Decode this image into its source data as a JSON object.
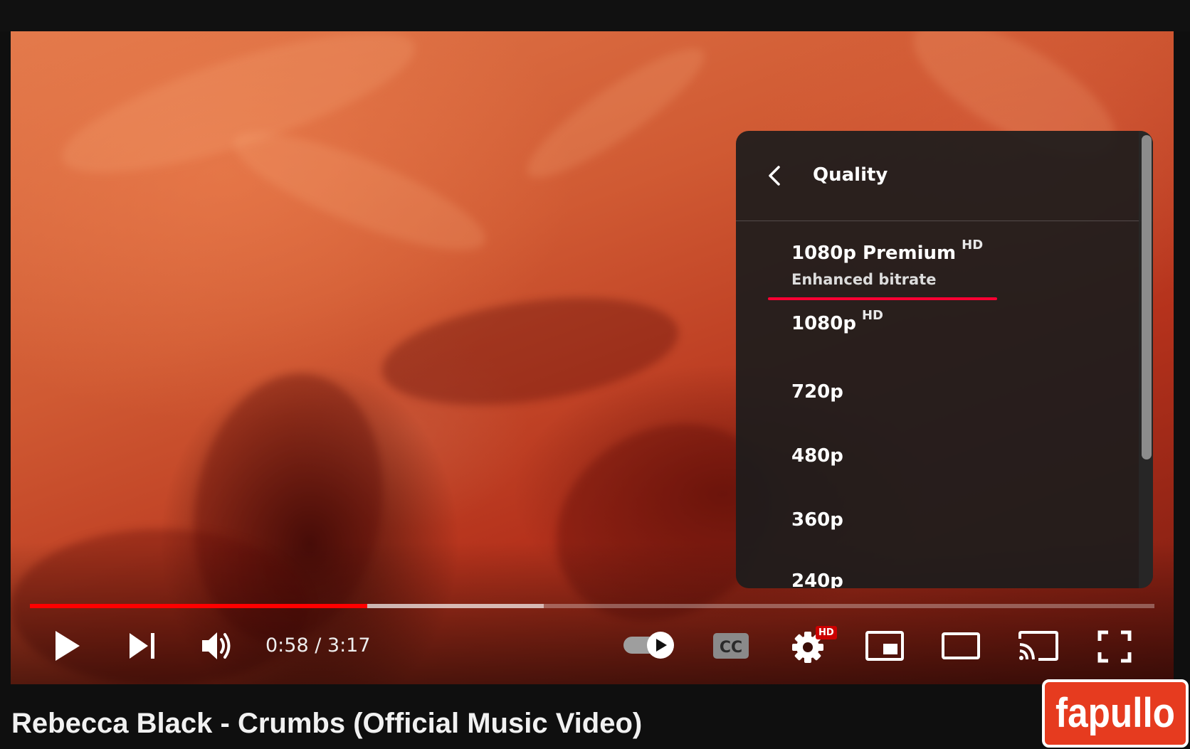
{
  "video": {
    "title": "Rebecca Black - Crumbs (Official Music Video)"
  },
  "player": {
    "progress": {
      "played_fraction": 0.3,
      "buffered_fraction": 0.457
    },
    "time": {
      "current": "0:58",
      "separator": " / ",
      "duration": "3:17"
    },
    "autoplay": {
      "enabled": true
    },
    "settings_badge": "HD",
    "icons": {
      "play": "play-icon",
      "next": "next-icon",
      "volume": "volume-icon",
      "autoplay": "autoplay-toggle-icon",
      "cc": "captions-icon",
      "settings": "gear-icon",
      "miniplayer": "miniplayer-icon",
      "theater": "theater-mode-icon",
      "cast": "cast-icon",
      "fullscreen": "fullscreen-icon"
    },
    "colors": {
      "progress": "#ff0000",
      "accent": "#ff0033",
      "badge": "#cc0000"
    }
  },
  "quality_menu": {
    "title": "Quality",
    "items": [
      {
        "label": "1080p Premium",
        "badge": "HD",
        "sublabel": "Enhanced bitrate",
        "selected": true
      },
      {
        "label": "1080p",
        "badge": "HD"
      },
      {
        "label": "720p"
      },
      {
        "label": "480p"
      },
      {
        "label": "360p"
      },
      {
        "label": "240p"
      }
    ]
  },
  "watermark": {
    "text": "fapullo"
  }
}
